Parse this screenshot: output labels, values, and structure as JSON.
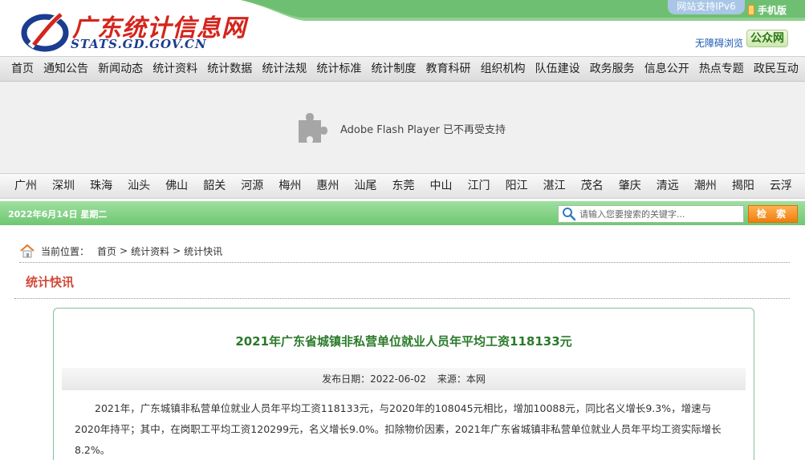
{
  "header": {
    "logo_cn": "广东统计信息网",
    "logo_en": "STATS.GD.GOV.CN",
    "ipv6_label": "网站支持IPv6",
    "mobile_label": "手机版",
    "accessibility_label": "无障碍浏览",
    "public_net_label": "公众网"
  },
  "main_nav": [
    "首页",
    "通知公告",
    "新闻动态",
    "统计资料",
    "统计数据",
    "统计法规",
    "统计标准",
    "统计制度",
    "教育科研",
    "组织机构",
    "队伍建设",
    "政务服务",
    "信息公开",
    "热点专题",
    "政民互动"
  ],
  "flash": {
    "message": "Adobe Flash Player 已不再受支持"
  },
  "city_nav": [
    "广州",
    "深圳",
    "珠海",
    "汕头",
    "佛山",
    "韶关",
    "河源",
    "梅州",
    "惠州",
    "汕尾",
    "东莞",
    "中山",
    "江门",
    "阳江",
    "湛江",
    "茂名",
    "肇庆",
    "清远",
    "潮州",
    "揭阳",
    "云浮"
  ],
  "date_bar": {
    "date": "2022年6月14日  星期二",
    "search_placeholder": "请输入您要搜索的关键字...",
    "search_button": "检 索"
  },
  "breadcrumb": {
    "label": "当前位置：",
    "items": [
      "首页",
      "统计资料",
      "统计快讯"
    ],
    "separator": ">"
  },
  "section_title": "统计快讯",
  "article": {
    "title": "2021年广东省城镇非私营单位就业人员年平均工资118133元",
    "date_label": "发布日期：2022-06-02",
    "source_label": "来源：本网",
    "body": "2021年，广东城镇非私营单位就业人员年平均工资118133元，与2020年的108045元相比，增加10088元，同比名义增长9.3%，增速与2020年持平；其中，在岗职工平均工资120299元，名义增长9.0%。扣除物价因素，2021年广东省城镇非私营单位就业人员年平均工资实际增长8.2%。"
  },
  "colors": {
    "logo_red": "#d4251c",
    "logo_blue": "#1b3d8f",
    "header_green": "#7cc47e",
    "date_bar_green": "#6fc772",
    "search_orange": "#f07d10",
    "article_title_green": "#2a7a2a",
    "section_title_red": "#d24a3a"
  }
}
